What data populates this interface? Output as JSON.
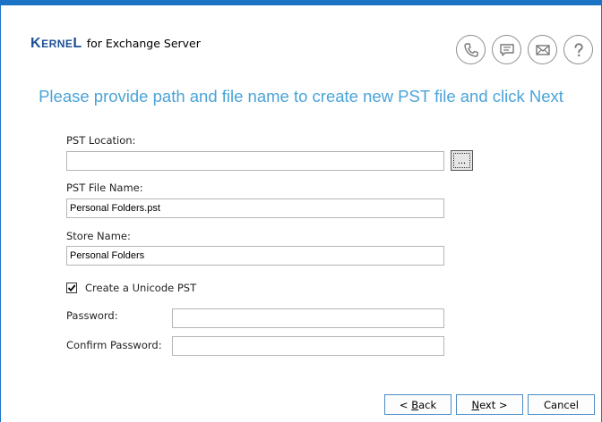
{
  "header": {
    "brand_big_1": "K",
    "brand_small": "ERNE",
    "brand_big_2": "L",
    "product": "for Exchange Server",
    "icons": [
      "phone-icon",
      "chat-icon",
      "mail-icon",
      "help-icon"
    ]
  },
  "instruction": "Please provide path and file name to create new PST file and click Next",
  "form": {
    "pst_location_label": "PST Location:",
    "pst_location_value": "",
    "browse_label": "...",
    "pst_file_name_label": "PST File Name:",
    "pst_file_name_value": "Personal Folders.pst",
    "store_name_label": "Store Name:",
    "store_name_value": "Personal Folders",
    "unicode_label": "Create a Unicode PST",
    "unicode_checked": true,
    "password_label": "Password:",
    "password_value": "",
    "confirm_password_label": "Confirm Password:",
    "confirm_password_value": ""
  },
  "buttons": {
    "back_pre": "< ",
    "back_key": "B",
    "back_post": "ack",
    "next_key": "N",
    "next_post": "ext >",
    "cancel": "Cancel"
  },
  "colors": {
    "accent": "#1a73c4",
    "headline": "#4aa3d8",
    "brand": "#1c4f96"
  }
}
